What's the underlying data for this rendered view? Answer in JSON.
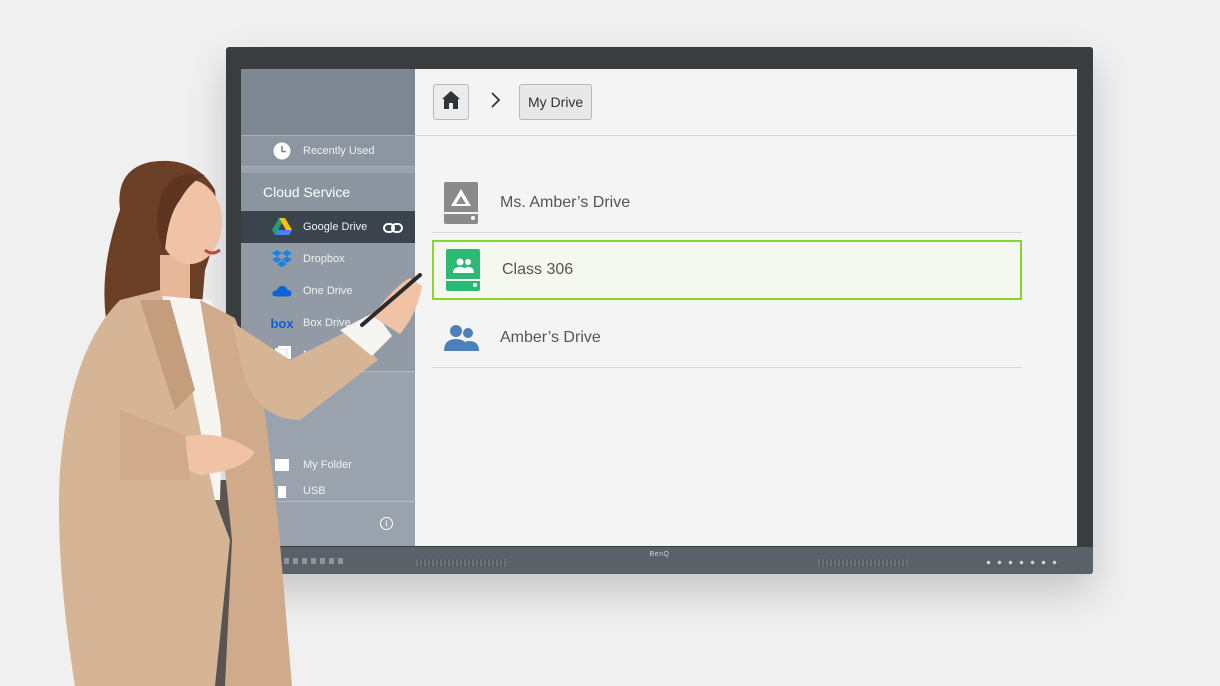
{
  "monitor": {
    "brand": "BenQ"
  },
  "sidebar": {
    "recent": {
      "label": "Recently Used",
      "icon": "clock-icon"
    },
    "cloud_header": "Cloud Service",
    "services": [
      {
        "label": "Google Drive",
        "icon": "google-drive-icon",
        "active": true
      },
      {
        "label": "Dropbox",
        "icon": "dropbox-icon"
      },
      {
        "label": "One Drive",
        "icon": "onedrive-icon"
      },
      {
        "label": "Box Drive",
        "icon": "box-icon",
        "icon_text": "box"
      },
      {
        "label": "Network F",
        "icon": "network-icon"
      }
    ],
    "local": [
      {
        "label": "My Folder",
        "icon": "folder-icon"
      },
      {
        "label": "USB",
        "icon": "usb-icon"
      }
    ],
    "info_icon": "i"
  },
  "main": {
    "breadcrumb": {
      "home_icon": "home-icon",
      "current": "My Drive"
    },
    "drives": [
      {
        "label": "Ms. Amber’s Drive",
        "icon": "shared-drive-icon"
      },
      {
        "label": "Class 306",
        "icon": "classroom-drive-icon",
        "selected": true
      },
      {
        "label": "Amber’s Drive",
        "icon": "people-icon"
      }
    ]
  },
  "colors": {
    "selection": "#8bd430",
    "sidebar_active": "#3b444d",
    "classroom_green": "#2eb876"
  }
}
